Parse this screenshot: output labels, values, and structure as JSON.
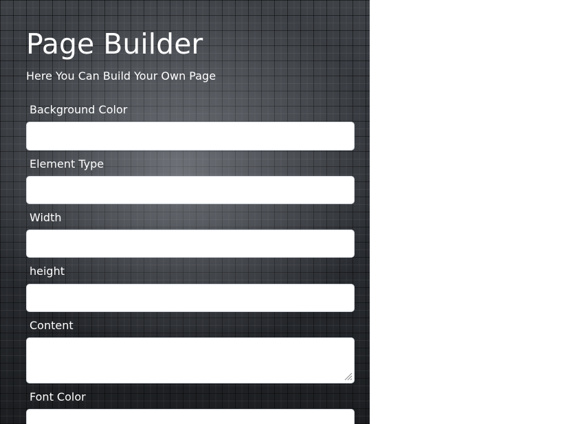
{
  "header": {
    "title": "Page Builder",
    "subtitle": "Here You Can Build Your Own Page"
  },
  "form": {
    "fields": [
      {
        "label": "Background Color",
        "value": "",
        "kind": "input"
      },
      {
        "label": "Element Type",
        "value": "",
        "kind": "input"
      },
      {
        "label": "Width",
        "value": "",
        "kind": "input"
      },
      {
        "label": "height",
        "value": "",
        "kind": "input"
      },
      {
        "label": "Content",
        "value": "",
        "kind": "textarea"
      },
      {
        "label": "Font Color",
        "value": "",
        "kind": "input"
      }
    ]
  },
  "colors": {
    "panel_background": "#2a2d31",
    "text": "#ffffff",
    "field_background": "#ffffff",
    "page_background": "#ffffff"
  },
  "icons": {
    "resize_handle": "resize-grip-icon"
  }
}
